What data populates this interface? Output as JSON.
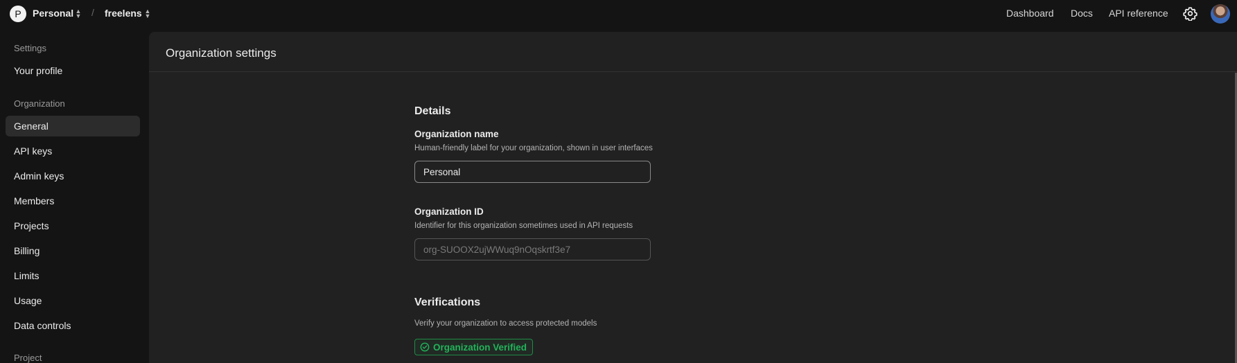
{
  "topbar": {
    "org_initial": "P",
    "org_name": "Personal",
    "separator": "/",
    "project_name": "freelens",
    "links": [
      "Dashboard",
      "Docs",
      "API reference"
    ]
  },
  "sidebar": {
    "settings_heading": "Settings",
    "profile_item": "Your profile",
    "organization_heading": "Organization",
    "items": [
      "General",
      "API keys",
      "Admin keys",
      "Members",
      "Projects",
      "Billing",
      "Limits",
      "Usage",
      "Data controls"
    ],
    "active_item": "General",
    "project_heading": "Project"
  },
  "main": {
    "title": "Organization settings",
    "details": {
      "heading": "Details",
      "org_name_label": "Organization name",
      "org_name_desc": "Human-friendly label for your organization, shown in user interfaces",
      "org_name_value": "Personal",
      "org_id_label": "Organization ID",
      "org_id_desc": "Identifier for this organization sometimes used in API requests",
      "org_id_value": "org-SUOOX2ujWWuq9nOqskrtf3e7"
    },
    "verifications": {
      "heading": "Verifications",
      "desc": "Verify your organization to access protected models",
      "badge": "Organization Verified",
      "badge_color": "#22b35a"
    }
  }
}
